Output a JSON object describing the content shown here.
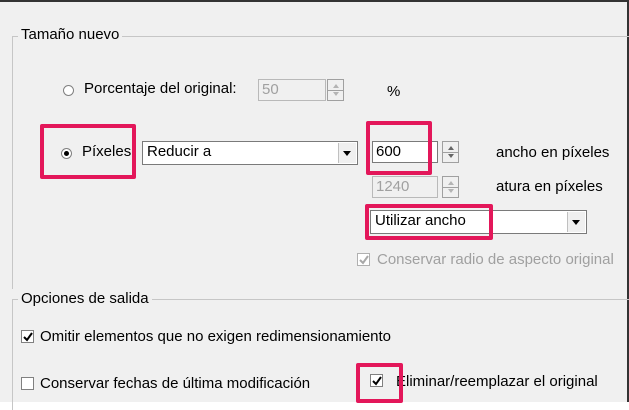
{
  "new_size": {
    "title": "Tamaño nuevo",
    "percent_option": {
      "label": "Porcentaje del original:",
      "value": "50",
      "unit": "%",
      "selected": false
    },
    "pixels_option": {
      "label": "Píxeles",
      "selected": true
    },
    "mode_select": {
      "value": "Reducir a"
    },
    "width": {
      "value": "600",
      "unit_label": "ancho en píxeles"
    },
    "height": {
      "value": "1240",
      "unit_label": "atura en píxeles"
    },
    "dimension_select": {
      "value": "Utilizar ancho"
    },
    "keep_aspect": {
      "label": "Conservar radio de aspecto original",
      "checked": true,
      "enabled": false
    }
  },
  "output_options": {
    "title": "Opciones de salida",
    "skip_resize": {
      "label": "Omitir elementos que no exigen redimensionamiento",
      "checked": true
    },
    "keep_dates": {
      "label": "Conservar fechas de última modificación",
      "checked": false
    },
    "replace_original": {
      "label": "Eliminar/reemplazar el original",
      "checked": true
    }
  },
  "colors": {
    "highlight": "#e3175a",
    "background": "#f0f0f0"
  }
}
